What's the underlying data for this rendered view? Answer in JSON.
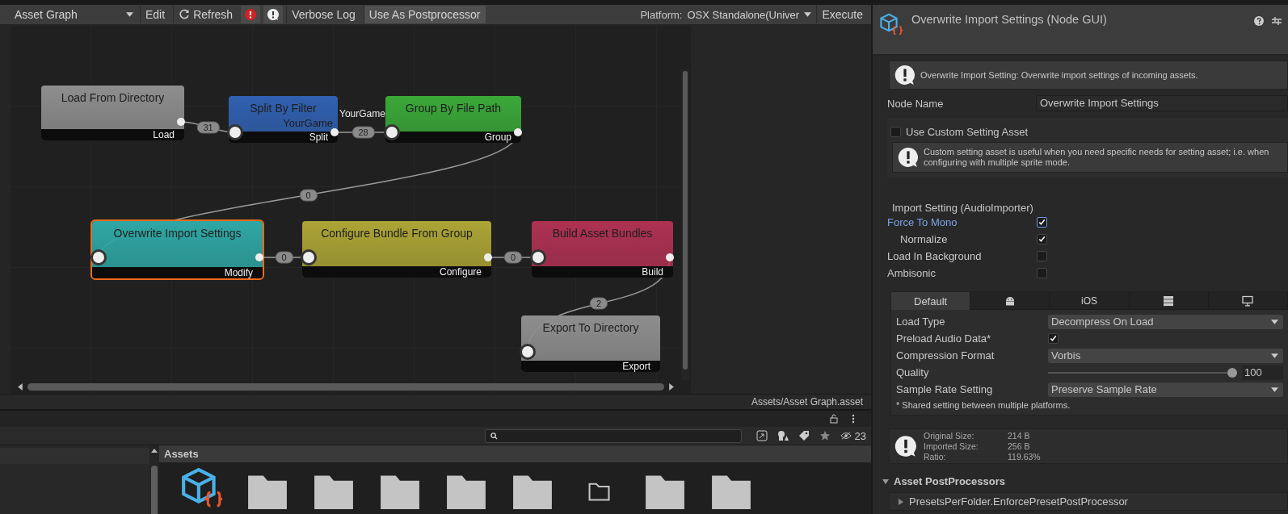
{
  "toolbar": {
    "graph_selector": "Asset Graph",
    "edit": "Edit",
    "refresh": "Refresh",
    "verbose_log": "Verbose Log",
    "use_as_postprocessor": "Use As Postprocessor",
    "platform_label": "Platform:",
    "platform": "OSX Standalone(Univer",
    "execute": "Execute"
  },
  "graph": {
    "nodes": [
      {
        "title": "Load From Directory",
        "output": "Load",
        "color": "#8e8e8e",
        "selected": false
      },
      {
        "title": "Split By Filter",
        "output": "Split",
        "port_label": "YourGame",
        "color": "#3060b0",
        "selected": false
      },
      {
        "title": "Group By File Path",
        "output": "Group",
        "color": "#3aa838",
        "selected": false
      },
      {
        "title": "Overwrite Import Settings",
        "output": "Modify",
        "color": "#2ea7a4",
        "selected": true
      },
      {
        "title": "Configure Bundle From Group",
        "output": "Configure",
        "color": "#aca435",
        "selected": false
      },
      {
        "title": "Build Asset Bundles",
        "output": "Build",
        "color": "#ae3152",
        "selected": false
      },
      {
        "title": "Export To Directory",
        "output": "Export",
        "color": "#8e8e8e",
        "selected": false
      }
    ],
    "edges": [
      {
        "count": "31"
      },
      {
        "count": "28",
        "label": "YourGame"
      },
      {
        "count": "0"
      },
      {
        "count": "0"
      },
      {
        "count": "0"
      },
      {
        "count": "2"
      }
    ]
  },
  "path": "Assets/Asset Graph.asset",
  "inspector": {
    "title": "Overwrite Import Settings (Node GUI)",
    "help": "Overwrite Import Setting: Overwrite import settings of incoming assets.",
    "node_name_label": "Node Name",
    "node_name": "Overwrite Import Settings",
    "use_custom": {
      "label": "Use Custom Setting Asset",
      "checked": false
    },
    "custom_help": "Custom setting asset is useful when you need specific needs for setting asset; i.e. when configuring with multiple sprite mode.",
    "import_header": "Import Setting (AudioImporter)",
    "toggles": [
      {
        "label": "Force To Mono",
        "checked": true,
        "selected": true,
        "children": [
          {
            "label": "Normalize",
            "checked": true,
            "selected": false
          }
        ]
      },
      {
        "label": "Load In Background",
        "checked": false,
        "selected": false
      },
      {
        "label": "Ambisonic",
        "checked": false,
        "selected": false
      }
    ],
    "platform_tabs": [
      {
        "kind": "text",
        "label": "Default",
        "selected": true
      },
      {
        "kind": "android",
        "selected": false
      },
      {
        "kind": "text",
        "label": "iOS",
        "selected": false
      },
      {
        "kind": "server",
        "selected": false
      },
      {
        "kind": "desktop",
        "selected": false
      }
    ],
    "settings": [
      {
        "kind": "dropdown",
        "label": "Load Type",
        "value": "Decompress On Load"
      },
      {
        "kind": "checkbox",
        "label": "Preload Audio Data*",
        "checked": true
      },
      {
        "kind": "dropdown",
        "label": "Compression Format",
        "value": "Vorbis"
      },
      {
        "kind": "slider",
        "label": "Quality",
        "level": 1,
        "value": "100"
      },
      {
        "kind": "dropdown",
        "label": "Sample Rate Setting",
        "value": "Preserve Sample Rate"
      }
    ],
    "note": "* Shared setting between multiple platforms.",
    "size_info": [
      {
        "label": "Original Size:",
        "value": "214 B"
      },
      {
        "label": "Imported Size:",
        "value": "256 B"
      },
      {
        "label": "Ratio:",
        "value": "119.63%"
      }
    ],
    "postprocessors": {
      "title": "Asset PostProcessors",
      "expanded": true,
      "items": [
        {
          "label": "PresetsPerFolder.EnforcePresetPostProcessor",
          "expanded": false
        }
      ]
    }
  },
  "project": {
    "hidden_count": "23",
    "breadcrumb": "Assets",
    "assets": [
      {
        "kind": "graph"
      },
      {
        "kind": "folder"
      },
      {
        "kind": "folder"
      },
      {
        "kind": "folder"
      },
      {
        "kind": "folder"
      },
      {
        "kind": "folder"
      },
      {
        "kind": "empty-folder"
      },
      {
        "kind": "folder"
      },
      {
        "kind": "folder"
      }
    ]
  }
}
